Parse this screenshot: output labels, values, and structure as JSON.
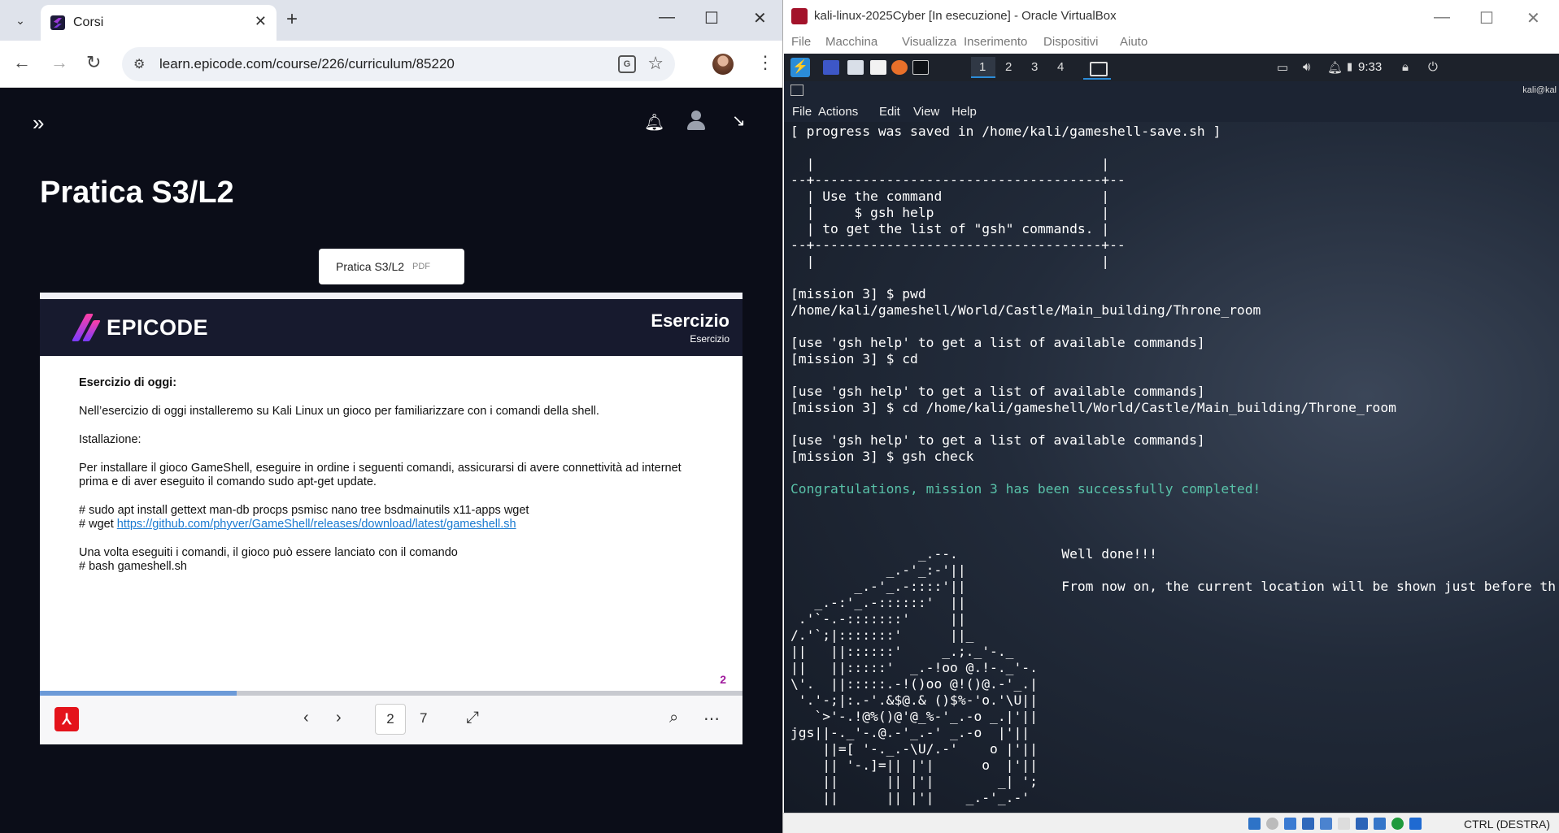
{
  "browser": {
    "tab": {
      "title": "Corsi"
    },
    "window_controls": {
      "minimize": "—",
      "maximize": "☐",
      "close": "✕"
    },
    "url": "learn.epicode.com/course/226/curriculum/85220",
    "page": {
      "title": "Pratica S3/L2",
      "pdf_chip": {
        "label": "Pratica S3/L2",
        "type": "PDF"
      },
      "slide": {
        "brand": "EPICODE",
        "title": "Esercizio",
        "subtitle": "Esercizio",
        "heading": "Esercizio di oggi:",
        "intro": "Nell’esercizio di oggi installeremo su Kali Linux un gioco per familiarizzare con i comandi della shell.",
        "install_heading": "Istallazione:",
        "install_text": "Per installare il gioco GameShell, eseguire in ordine i seguenti comandi, assicurarsi di avere connettività ad internet prima e di aver eseguito il comando sudo apt-get update.",
        "cmd1": "# sudo apt install gettext man-db procps psmisc nano tree bsdmainutils x11-apps wget",
        "cmd2_prefix": "# wget ",
        "cmd2_link": "https://github.com/phyver/GameShell/releases/download/latest/gameshell.sh",
        "outro": "Una volta eseguiti i comandi, il gioco può essere lanciato con il comando",
        "cmd3": "# bash gameshell.sh",
        "page_badge": "2"
      },
      "viewer": {
        "current_page": "2",
        "total_pages": "7",
        "progress_fraction": 0.28
      }
    }
  },
  "vbox": {
    "title": "kali-linux-2025Cyber [In esecuzione] - Oracle VirtualBox",
    "menu": [
      "File",
      "Macchina",
      "Visualizza",
      "Inserimento",
      "Dispositivi",
      "Aiuto"
    ],
    "panel": {
      "workspaces": [
        "1",
        "2",
        "3",
        "4"
      ],
      "clock": "9:33"
    },
    "terminal": {
      "user": "kali@kal",
      "menu": [
        "File",
        "Actions",
        "Edit",
        "View",
        "Help"
      ],
      "lines": [
        {
          "text": "[ progress was saved in /home/kali/gameshell-save.sh ]"
        },
        {
          "text": ""
        },
        {
          "text": "  |                                    |"
        },
        {
          "text": "--+------------------------------------+--"
        },
        {
          "text": "  | Use the command                    |"
        },
        {
          "text": "  |     $ gsh help                     |"
        },
        {
          "text": "  | to get the list of \"gsh\" commands. |"
        },
        {
          "text": "--+------------------------------------+--"
        },
        {
          "text": "  |                                    |"
        },
        {
          "text": ""
        },
        {
          "text": "[mission 3] $ pwd"
        },
        {
          "text": "/home/kali/gameshell/World/Castle/Main_building/Throne_room"
        },
        {
          "text": ""
        },
        {
          "text": "[use 'gsh help' to get a list of available commands]"
        },
        {
          "text": "[mission 3] $ cd"
        },
        {
          "text": ""
        },
        {
          "text": "[use 'gsh help' to get a list of available commands]"
        },
        {
          "text": "[mission 3] $ cd /home/kali/gameshell/World/Castle/Main_building/Throne_room"
        },
        {
          "text": ""
        },
        {
          "text": "[use 'gsh help' to get a list of available commands]"
        },
        {
          "text": "[mission 3] $ gsh check"
        },
        {
          "text": ""
        },
        {
          "text": "Congratulations, mission 3 has been successfully completed!",
          "green": true
        },
        {
          "text": ""
        },
        {
          "text": ""
        },
        {
          "text": ""
        },
        {
          "text": "                _.--.             Well done!!!"
        },
        {
          "text": "            _.-'_:-'||"
        },
        {
          "text": "        _.-'_.-::::'||            From now on, the current location will be shown just before th"
        },
        {
          "text": "   _.-:'_.-::::::'  ||"
        },
        {
          "text": " .'`-.-:::::::'     ||"
        },
        {
          "text": "/.'`;|:::::::'      ||_"
        },
        {
          "text": "||   ||::::::'     _.;._'-._"
        },
        {
          "text": "||   ||:::::'  _.-!oo @.!-._'-."
        },
        {
          "text": "\\'.  ||:::::.-!()oo @!()@.-'_.|"
        },
        {
          "text": " '.'-;|:.-'.&$@.& ()$%-'o.'\\U||"
        },
        {
          "text": "   `>'-.!@%()@'@_%-'_.-o _.|'||"
        },
        {
          "text": "jgs||-._'-.@.-'_.-' _.-o  |'||"
        },
        {
          "text": "    ||=[ '-._.-\\U/.-'    o |'||"
        },
        {
          "text": "    || '-.]=|| |'|      o  |'||"
        },
        {
          "text": "    ||      || |'|        _| ';"
        },
        {
          "text": "    ||      || |'|    _.-'_.-'"
        }
      ]
    },
    "status": {
      "host_key": "CTRL (DESTRA)"
    }
  }
}
